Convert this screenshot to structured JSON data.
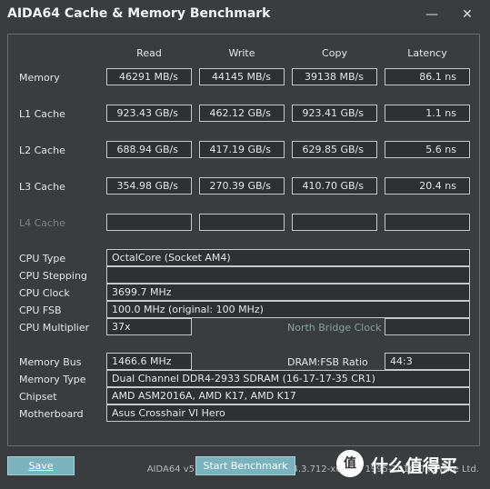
{
  "window": {
    "title": "AIDA64 Cache & Memory Benchmark",
    "minimize_icon": "minimize-icon",
    "close_icon": "close-icon"
  },
  "columns": [
    "Read",
    "Write",
    "Copy",
    "Latency"
  ],
  "rows": [
    {
      "label": "Memory",
      "read": "46291 MB/s",
      "write": "44145 MB/s",
      "copy": "39138 MB/s",
      "latency": "86.1 ns"
    },
    {
      "label": "L1 Cache",
      "read": "923.43 GB/s",
      "write": "462.12 GB/s",
      "copy": "923.41 GB/s",
      "latency": "1.1 ns"
    },
    {
      "label": "L2 Cache",
      "read": "688.94 GB/s",
      "write": "417.19 GB/s",
      "copy": "629.85 GB/s",
      "latency": "5.6 ns"
    },
    {
      "label": "L3 Cache",
      "read": "354.98 GB/s",
      "write": "270.39 GB/s",
      "copy": "410.70 GB/s",
      "latency": "20.4 ns"
    },
    {
      "label": "L4 Cache",
      "read": "",
      "write": "",
      "copy": "",
      "latency": ""
    }
  ],
  "cpu": {
    "type_label": "CPU Type",
    "type_value": "OctalCore   (Socket AM4)",
    "stepping_label": "CPU Stepping",
    "stepping_value": "",
    "clock_label": "CPU Clock",
    "clock_value": "3699.7 MHz",
    "fsb_label": "CPU FSB",
    "fsb_value": "100.0 MHz  (original: 100 MHz)",
    "multiplier_label": "CPU Multiplier",
    "multiplier_value": "37x",
    "north_bridge_label": "North Bridge Clock",
    "north_bridge_value": ""
  },
  "memory": {
    "bus_label": "Memory Bus",
    "bus_value": "1466.6 MHz",
    "ratio_label": "DRAM:FSB Ratio",
    "ratio_value": "44:3",
    "type_label": "Memory Type",
    "type_value": "Dual Channel DDR4-2933 SDRAM  (16-17-17-35 CR1)",
    "chipset_label": "Chipset",
    "chipset_value": "AMD ASM2016A, AMD K17, AMD K17",
    "motherboard_label": "Motherboard",
    "motherboard_value": "Asus Crosshair VI Hero"
  },
  "footer": "AIDA64 v5.80.4000 / BenchDLL 4.3.712-x64  (c) 1995-2016 FinalWire Ltd.",
  "buttons": {
    "save": "Save",
    "start": "Start Benchmark"
  },
  "watermark": {
    "mark": "值",
    "text": "什么值得买"
  }
}
